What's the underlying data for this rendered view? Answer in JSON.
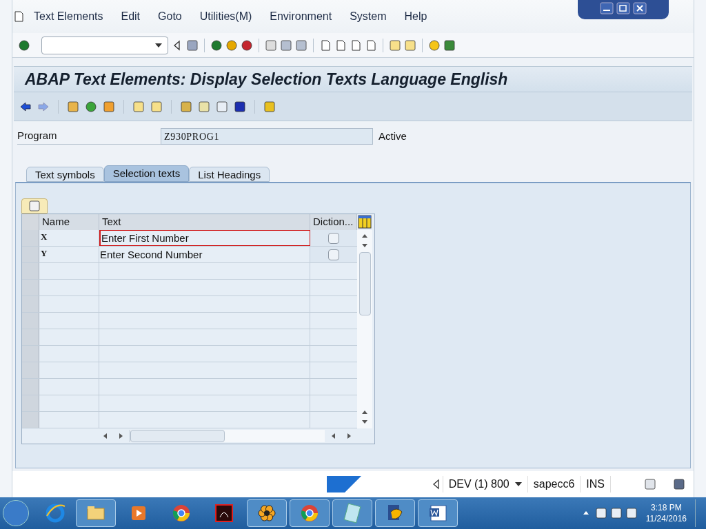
{
  "menu": [
    "Text Elements",
    "Edit",
    "Goto",
    "Utilities(M)",
    "Environment",
    "System",
    "Help"
  ],
  "title": "ABAP Text Elements: Display Selection Texts Language English",
  "program": {
    "label": "Program",
    "value": "Z930PROG1",
    "status": "Active"
  },
  "tabs": [
    {
      "label": "Text symbols",
      "selected": false
    },
    {
      "label": "Selection texts",
      "selected": true
    },
    {
      "label": "List Headings",
      "selected": false
    }
  ],
  "table": {
    "columns": [
      "Name",
      "Text",
      "Diction..."
    ],
    "rows": [
      {
        "name": "X",
        "text": "Enter First Number",
        "checked": false,
        "focused": true
      },
      {
        "name": "Y",
        "text": "Enter Second Number",
        "checked": false,
        "focused": false
      }
    ]
  },
  "status_bar": {
    "system": "DEV (1) 800",
    "server": "sapecc6",
    "mode": "INS"
  },
  "taskbar": {
    "apps": [
      {
        "kind": "explorer",
        "open": true
      },
      {
        "kind": "media",
        "open": false
      },
      {
        "kind": "chrome",
        "open": false
      },
      {
        "kind": "pdf",
        "open": false
      },
      {
        "kind": "flower",
        "open": true
      },
      {
        "kind": "chrome",
        "open": true
      },
      {
        "kind": "notepad",
        "open": true
      },
      {
        "kind": "sap",
        "open": true
      },
      {
        "kind": "word",
        "open": true
      }
    ],
    "time": "3:18 PM",
    "date": "11/24/2016"
  }
}
